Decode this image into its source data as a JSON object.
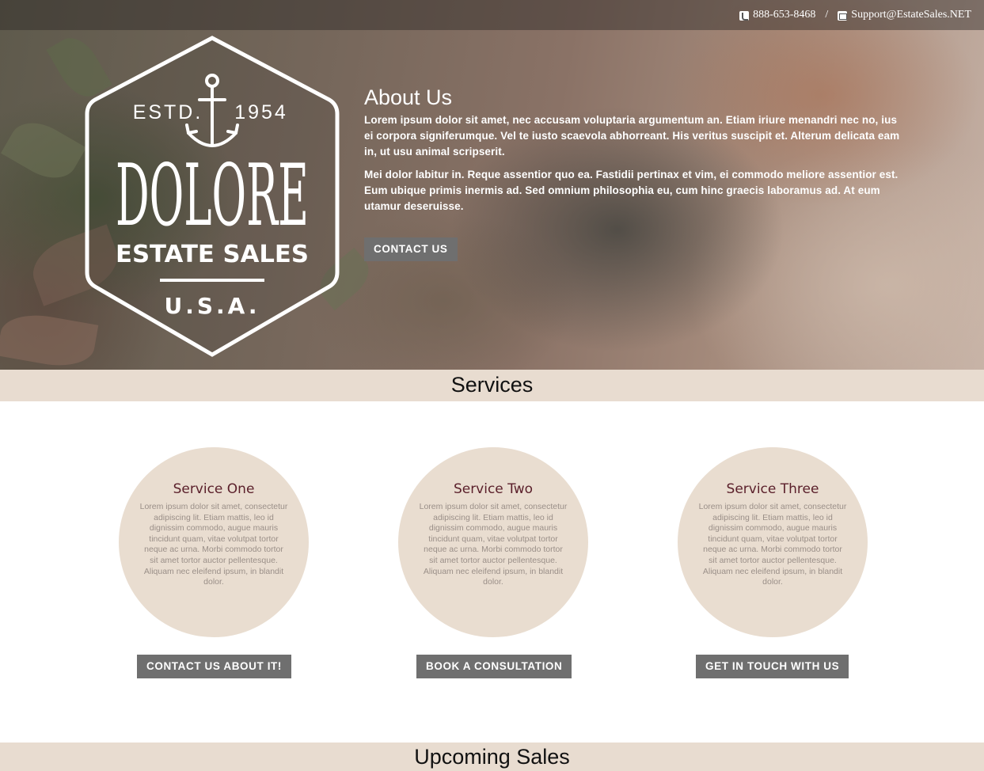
{
  "topbar": {
    "phone": "888-653-8468",
    "separator": "/",
    "email": "Support@EstateSales.NET"
  },
  "logo": {
    "estd": "ESTD.",
    "year": "1954",
    "name": "DOLORE",
    "tagline": "ESTATE SALES",
    "country": "U.S.A."
  },
  "about": {
    "title": "About Us",
    "paragraphs": [
      "Lorem ipsum dolor sit amet, nec accusam voluptaria argumentum an. Etiam iriure menandri nec no, ius ei corpora signiferumque. Vel te iusto scaevola abhorreant. His veritus suscipit et. Alterum delicata eam in, ut usu animal scripserit.",
      "Mei dolor labitur in. Reque assentior quo ea. Fastidii pertinax et vim, ei commodo meliore assentior est. Eum ubique primis inermis ad. Sed omnium philosophia eu, cum hinc graecis laboramus ad. At eum utamur deseruisse."
    ],
    "button": "CONTACT US"
  },
  "services": {
    "title": "Services",
    "items": [
      {
        "title": "Service One",
        "text": "Lorem ipsum dolor sit amet, consectetur adipiscing lit. Etiam mattis, leo id dignissim commodo, augue mauris tincidunt quam, vitae volutpat tortor neque ac urna. Morbi commodo tortor sit amet tortor auctor pellentesque. Aliquam nec eleifend ipsum, in blandit dolor.",
        "button": "CONTACT US ABOUT IT!"
      },
      {
        "title": "Service Two",
        "text": "Lorem ipsum dolor sit amet, consectetur adipiscing lit. Etiam mattis, leo id dignissim commodo, augue mauris tincidunt quam, vitae volutpat tortor neque ac urna. Morbi commodo tortor sit amet tortor auctor pellentesque. Aliquam nec eleifend ipsum, in blandit dolor.",
        "button": "BOOK A CONSULTATION"
      },
      {
        "title": "Service Three",
        "text": "Lorem ipsum dolor sit amet, consectetur adipiscing lit. Etiam mattis, leo id dignissim commodo, augue mauris tincidunt quam, vitae volutpat tortor neque ac urna. Morbi commodo tortor sit amet tortor auctor pellentesque. Aliquam nec eleifend ipsum, in blandit dolor.",
        "button": "GET IN TOUCH WITH US"
      }
    ]
  },
  "upcoming": {
    "title": "Upcoming Sales"
  },
  "colors": {
    "band": "#e8dcd0",
    "circle": "#e9ddd0",
    "service_title": "#5a1f2a",
    "button": "#6f6f6f"
  }
}
